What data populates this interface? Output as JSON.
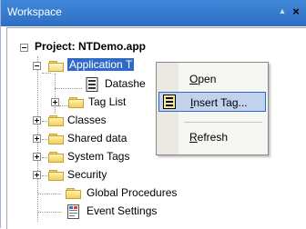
{
  "window": {
    "title": "Workspace",
    "pin_glyph": "▲",
    "close_glyph": "×"
  },
  "tree": {
    "project": "Project: NTDemo.app",
    "application": "Application T",
    "datasheet": "Datashe",
    "tag_list": "Tag List",
    "classes": "Classes",
    "shared_data": "Shared data",
    "system_tags": "System Tags",
    "security": "Security",
    "global_procedures": "Global Procedures",
    "event_settings": "Event Settings"
  },
  "context_menu": {
    "open": {
      "accel": "O",
      "rest": "pen"
    },
    "insert_tag": {
      "accel": "I",
      "rest": "nsert Tag..."
    },
    "refresh": {
      "accel": "R",
      "rest": "efresh"
    }
  },
  "colors": {
    "title_bar": "#3373cc",
    "selection": "#316ac5",
    "menu_hover": "#c1d2ee"
  },
  "icons": [
    "pin-icon",
    "close-icon",
    "folder-icon",
    "datasheet-icon",
    "tag-list-icon",
    "event-settings-icon",
    "insert-tag-icon"
  ]
}
